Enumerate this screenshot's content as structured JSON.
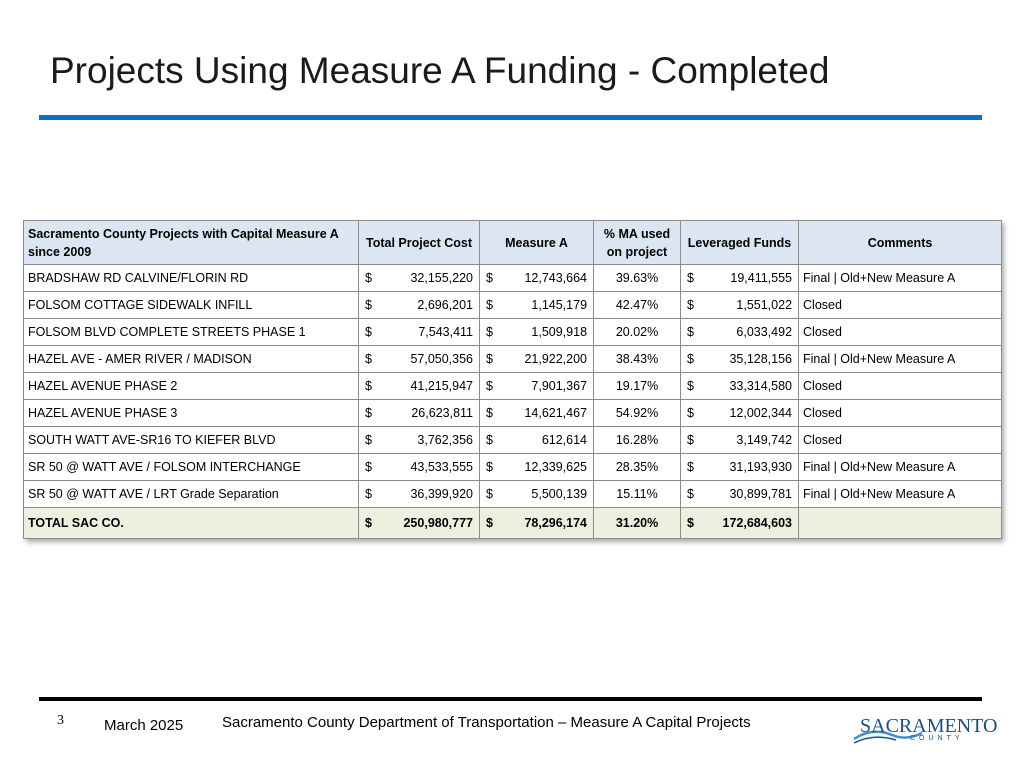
{
  "title": "Projects Using Measure A Funding - Completed",
  "table": {
    "headers": {
      "project": "Sacramento County Projects with Capital Measure A since 2009",
      "total_cost": "Total Project Cost",
      "measure_a": "Measure A",
      "pct_ma": "% MA used on project",
      "leveraged": "Leveraged Funds",
      "comments": "Comments"
    },
    "currency_symbol": "$",
    "rows": [
      {
        "name": "BRADSHAW RD CALVINE/FLORIN RD",
        "total": "32,155,220",
        "ma": "12,743,664",
        "pct": "39.63%",
        "lev": "19,411,555",
        "comment": "Final | Old+New Measure A"
      },
      {
        "name": "FOLSOM COTTAGE SIDEWALK INFILL",
        "total": "2,696,201",
        "ma": "1,145,179",
        "pct": "42.47%",
        "lev": "1,551,022",
        "comment": "Closed"
      },
      {
        "name": "FOLSOM BLVD COMPLETE STREETS PHASE 1",
        "total": "7,543,411",
        "ma": "1,509,918",
        "pct": "20.02%",
        "lev": "6,033,492",
        "comment": "Closed"
      },
      {
        "name": "HAZEL AVE - AMER RIVER / MADISON",
        "total": "57,050,356",
        "ma": "21,922,200",
        "pct": "38.43%",
        "lev": "35,128,156",
        "comment": "Final | Old+New Measure A"
      },
      {
        "name": "HAZEL AVENUE PHASE 2",
        "total": "41,215,947",
        "ma": "7,901,367",
        "pct": "19.17%",
        "lev": "33,314,580",
        "comment": "Closed"
      },
      {
        "name": "HAZEL AVENUE PHASE 3",
        "total": "26,623,811",
        "ma": "14,621,467",
        "pct": "54.92%",
        "lev": "12,002,344",
        "comment": "Closed"
      },
      {
        "name": " SOUTH WATT AVE-SR16 TO KIEFER BLVD",
        "total": "3,762,356",
        "ma": "612,614",
        "pct": "16.28%",
        "lev": "3,149,742",
        "comment": "Closed"
      },
      {
        "name": "SR 50 @ WATT AVE / FOLSOM INTERCHANGE",
        "total": "43,533,555",
        "ma": "12,339,625",
        "pct": "28.35%",
        "lev": "31,193,930",
        "comment": "Final | Old+New Measure A"
      },
      {
        "name": " SR 50 @ WATT AVE / LRT Grade Separation",
        "total": "36,399,920",
        "ma": "5,500,139",
        "pct": "15.11%",
        "lev": "30,899,781",
        "comment": "Final | Old+New Measure A"
      }
    ],
    "total_row": {
      "name": "TOTAL SAC CO.",
      "total": "250,980,777",
      "ma": "78,296,174",
      "pct": "31.20%",
      "lev": "172,684,603",
      "comment": ""
    }
  },
  "footer": {
    "page_number": "3",
    "date": "March 2025",
    "text": "Sacramento County Department of Transportation – Measure A Capital Projects",
    "logo_word": "SACRAMENTO",
    "logo_sub": "COUNTY"
  },
  "colors": {
    "accent_rule": "#0b6fc6",
    "header_fill": "#dce6f2",
    "total_fill": "#ebf1de",
    "logo": "#1b4f86"
  }
}
